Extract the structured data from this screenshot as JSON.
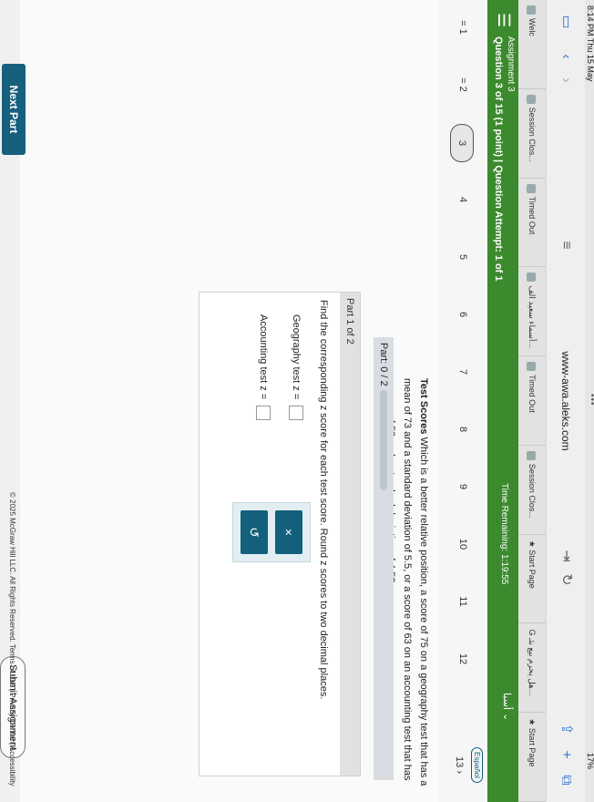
{
  "status": {
    "time": "8:14 PM  Thu 15 May",
    "battery": "17%"
  },
  "browser": {
    "url": "www-awa.aleks.com"
  },
  "tabs": [
    {
      "label": "Welc"
    },
    {
      "label": "Session Clos..."
    },
    {
      "label": "Timed Out"
    },
    {
      "label": "أسماء سعيد الف..."
    },
    {
      "label": "Timed Out"
    },
    {
      "label": "Session Clos..."
    },
    {
      "label": "Start Page"
    },
    {
      "label": "هل يحرم بيع بئـ..."
    },
    {
      "label": "Start Page"
    }
  ],
  "header": {
    "assignment": "Assignment 3",
    "question_info": "Question 3 of 15 (1 point)  |  Question Attempt: 1 of 1",
    "time_remaining": "Time Remaining: 1:19:55",
    "lang_button": "أسبا"
  },
  "question_nav": {
    "items": [
      "= 1",
      "= 2",
      "3",
      "4",
      "5",
      "6",
      "7",
      "8",
      "9",
      "10",
      "11",
      "12",
      "13"
    ],
    "current": "3",
    "espanol": "Español"
  },
  "problem": {
    "title": "Test Scores",
    "text": "Which is a better relative position, a score of 75 on a geography test that has a mean of 73 and a standard deviation of 5.5, or a score of 63 on an accounting test that has a mean of 53 and a standard deviation of 4.5?",
    "part_label": "Part: 0 / 2",
    "part_header": "Part 1 of 2",
    "instruction": "Find the corresponding z score for each test score. Round z scores to two decimal places.",
    "geography_label": "Geography test z =",
    "accounting_label": "Accounting test z =",
    "clear_icon": "×",
    "undo_icon": "↺"
  },
  "footer": {
    "next_part": "Next Part",
    "submit": "Submit Assignment",
    "copyright": "© 2025 McGraw Hill LLC. All Rights Reserved.   Terms of Use  |  Privacy Center  |  Accessibility"
  }
}
